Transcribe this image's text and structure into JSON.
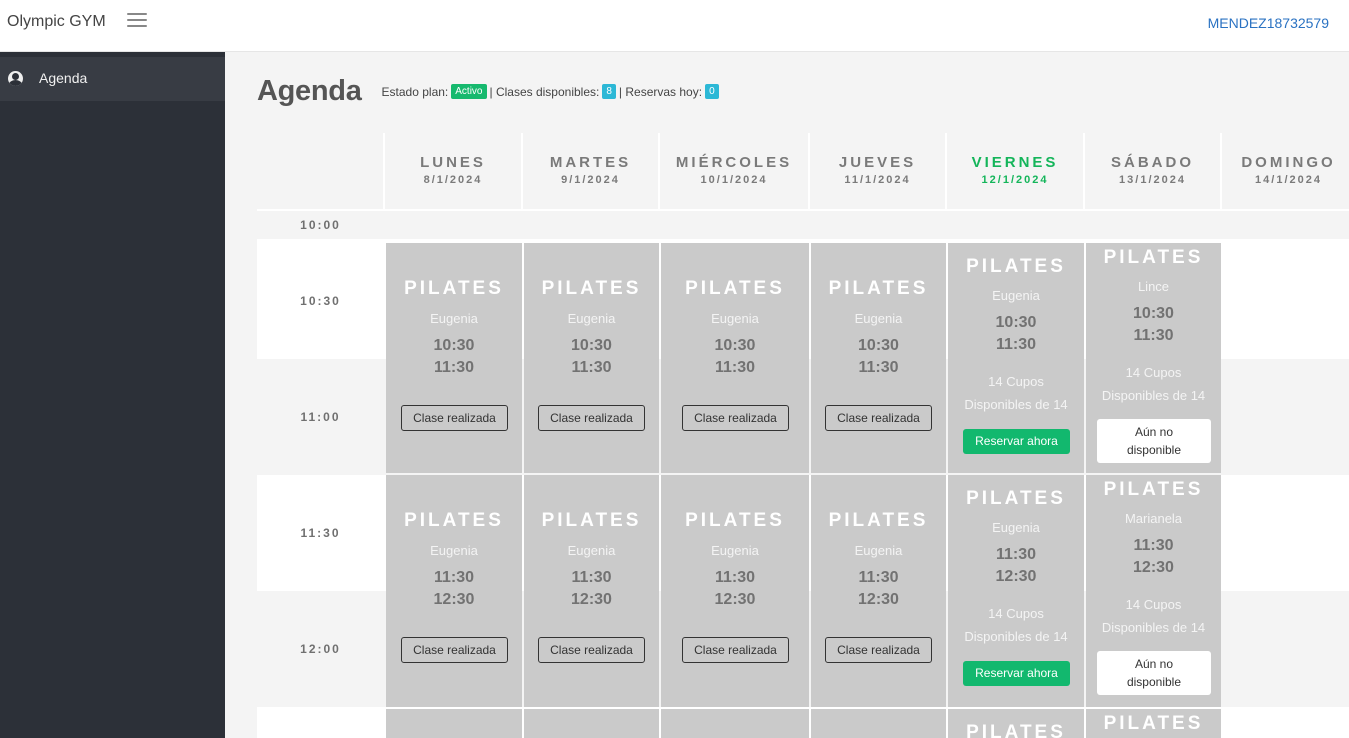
{
  "app": {
    "brand": "Olympic GYM",
    "user": "MENDEZ18732579"
  },
  "sidebar": {
    "items": [
      {
        "label": "Agenda",
        "icon": "user-circle-icon"
      }
    ]
  },
  "header": {
    "title": "Agenda",
    "estado_label": "Estado plan:",
    "estado_value": "Activo",
    "clases_label": "| Clases disponibles:",
    "clases_value": "8",
    "reservas_label": "| Reservas hoy:",
    "reservas_value": "0"
  },
  "colors": {
    "sidebar": "#2c3038",
    "accent_green": "#12b86e",
    "badge_blue": "#2cb8d6",
    "card": "#cacaca",
    "link": "#2a72c2"
  },
  "days": [
    {
      "name": "LUNES",
      "date": "8/1/2024"
    },
    {
      "name": "MARTES",
      "date": "9/1/2024"
    },
    {
      "name": "MIÉRCOLES",
      "date": "10/1/2024"
    },
    {
      "name": "JUEVES",
      "date": "11/1/2024"
    },
    {
      "name": "VIERNES",
      "date": "12/1/2024",
      "today": true
    },
    {
      "name": "SÁBADO",
      "date": "13/1/2024"
    },
    {
      "name": "DOMINGO",
      "date": "14/1/2024"
    }
  ],
  "times": [
    "10:00",
    "10:30",
    "11:00",
    "11:30",
    "12:00"
  ],
  "slot1": {
    "past": {
      "title": "PILATES",
      "instructor": "Eugenia",
      "start": "10:30",
      "end": "11:30",
      "button": "Clase realizada"
    },
    "viernes": {
      "title": "PILATES",
      "instructor": "Eugenia",
      "start": "10:30",
      "end": "11:30",
      "cupos": "14 Cupos",
      "disponibles": "Disponibles de 14",
      "button": "Reservar ahora"
    },
    "sabado": {
      "title": "PILATES",
      "instructor": "Lince",
      "start": "10:30",
      "end": "11:30",
      "cupos": "14 Cupos",
      "disponibles": "Disponibles de 14",
      "button_line1": "Aún no",
      "button_line2": "disponible"
    }
  },
  "slot2": {
    "past": {
      "title": "PILATES",
      "instructor": "Eugenia",
      "start": "11:30",
      "end": "12:30",
      "button": "Clase realizada"
    },
    "viernes": {
      "title": "PILATES",
      "instructor": "Eugenia",
      "start": "11:30",
      "end": "12:30",
      "cupos": "14 Cupos",
      "disponibles": "Disponibles de 14",
      "button": "Reservar ahora"
    },
    "sabado": {
      "title": "PILATES",
      "instructor": "Marianela",
      "start": "11:30",
      "end": "12:30",
      "cupos": "14 Cupos",
      "disponibles": "Disponibles de 14",
      "button_line1": "Aún no",
      "button_line2": "disponible"
    }
  },
  "slot3": {
    "viernes_title": "PILATES",
    "sabado_title": "PILATES"
  }
}
